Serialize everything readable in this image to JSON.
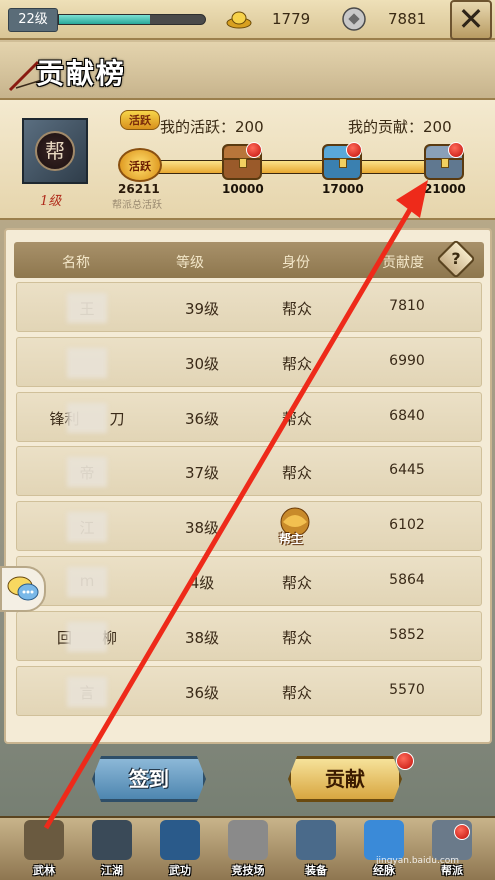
{
  "topbar": {
    "level": "22级",
    "xp_progress": 0.62,
    "gold": "1779",
    "silver": "7881"
  },
  "title": "贡献榜",
  "activity": {
    "badge": "活跃",
    "my_activity": "我的活跃：200",
    "my_contribution": "我的贡献：200",
    "guild_level": "1级",
    "guild_emblem_char": "帮",
    "total_activity": "26211",
    "total_label": "帮派总活跃",
    "progress": 1.0,
    "milestones": [
      "10000",
      "17000",
      "21000"
    ]
  },
  "table": {
    "headers": [
      "名称",
      "等级",
      "身份",
      "贡献度"
    ],
    "rows": [
      {
        "name": "王",
        "level": "39级",
        "role": "帮众",
        "contrib": "7810"
      },
      {
        "name": "",
        "level": "30级",
        "role": "帮众",
        "contrib": "6990"
      },
      {
        "name": "锋利　　刀",
        "level": "36级",
        "role": "帮众",
        "contrib": "6840"
      },
      {
        "name": "帝",
        "level": "37级",
        "role": "帮众",
        "contrib": "6445"
      },
      {
        "name": "江",
        "level": "38级",
        "role": "帮主",
        "contrib": "6102"
      },
      {
        "name": "m",
        "level": "4级",
        "role": "帮众",
        "contrib": "5864"
      },
      {
        "name": "回　　柳",
        "level": "38级",
        "role": "帮众",
        "contrib": "5852"
      },
      {
        "name": "言",
        "level": "36级",
        "role": "帮众",
        "contrib": "5570"
      }
    ]
  },
  "buttons": {
    "sign_in": "签到",
    "contribute": "贡献"
  },
  "nav": [
    {
      "label": "武林",
      "icon": "tower-icon"
    },
    {
      "label": "江湖",
      "icon": "swordsman-icon"
    },
    {
      "label": "武功",
      "icon": "scroll-icon"
    },
    {
      "label": "竞技场",
      "icon": "crossed-swords-icon"
    },
    {
      "label": "装备",
      "icon": "armor-icon"
    },
    {
      "label": "经脉",
      "icon": "orb-icon"
    },
    {
      "label": "帮派",
      "icon": "guild-icon"
    }
  ],
  "watermark": "jingyan.baidu.com",
  "colors": {
    "accent_red": "#e8281a",
    "header_bg": "#9a8460",
    "row_bg": "#e6dabe"
  }
}
